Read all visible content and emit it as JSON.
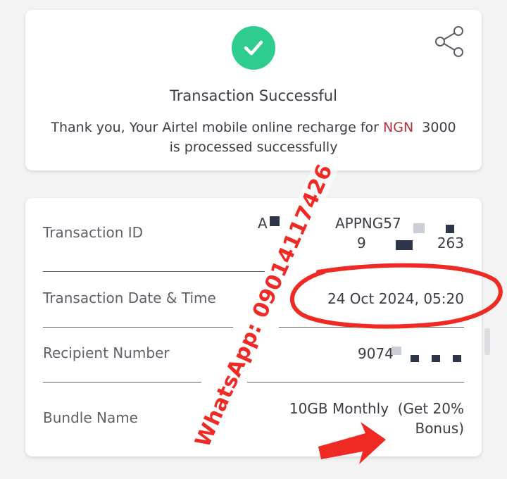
{
  "status": {
    "title": "Transaction Successful",
    "message_prefix": "Thank you, Your Airtel mobile online recharge for",
    "currency": "NGN",
    "amount": "3000",
    "message_suffix": "is processed successfully"
  },
  "details": {
    "transaction_id": {
      "label": "Transaction ID",
      "value_line1_start": "A",
      "value_line1_mid": "APPNG57",
      "value_line2_start": "9",
      "value_line2_end": "263"
    },
    "date_time": {
      "label": "Transaction Date & Time",
      "value": "24 Oct 2024, 05:20"
    },
    "recipient": {
      "label": "Recipient Number",
      "value": "9074"
    },
    "bundle": {
      "label": "Bundle Name",
      "value_line1": "10GB Monthly  (Get 20%",
      "value_line2": "Bonus)"
    }
  },
  "watermark": {
    "text": "WhatsApp: 09014117426"
  },
  "colors": {
    "success": "#2ecc8f",
    "accent": "#b3313c",
    "annotation": "#ef2a24"
  },
  "icons": [
    "check-icon",
    "share-icon"
  ]
}
